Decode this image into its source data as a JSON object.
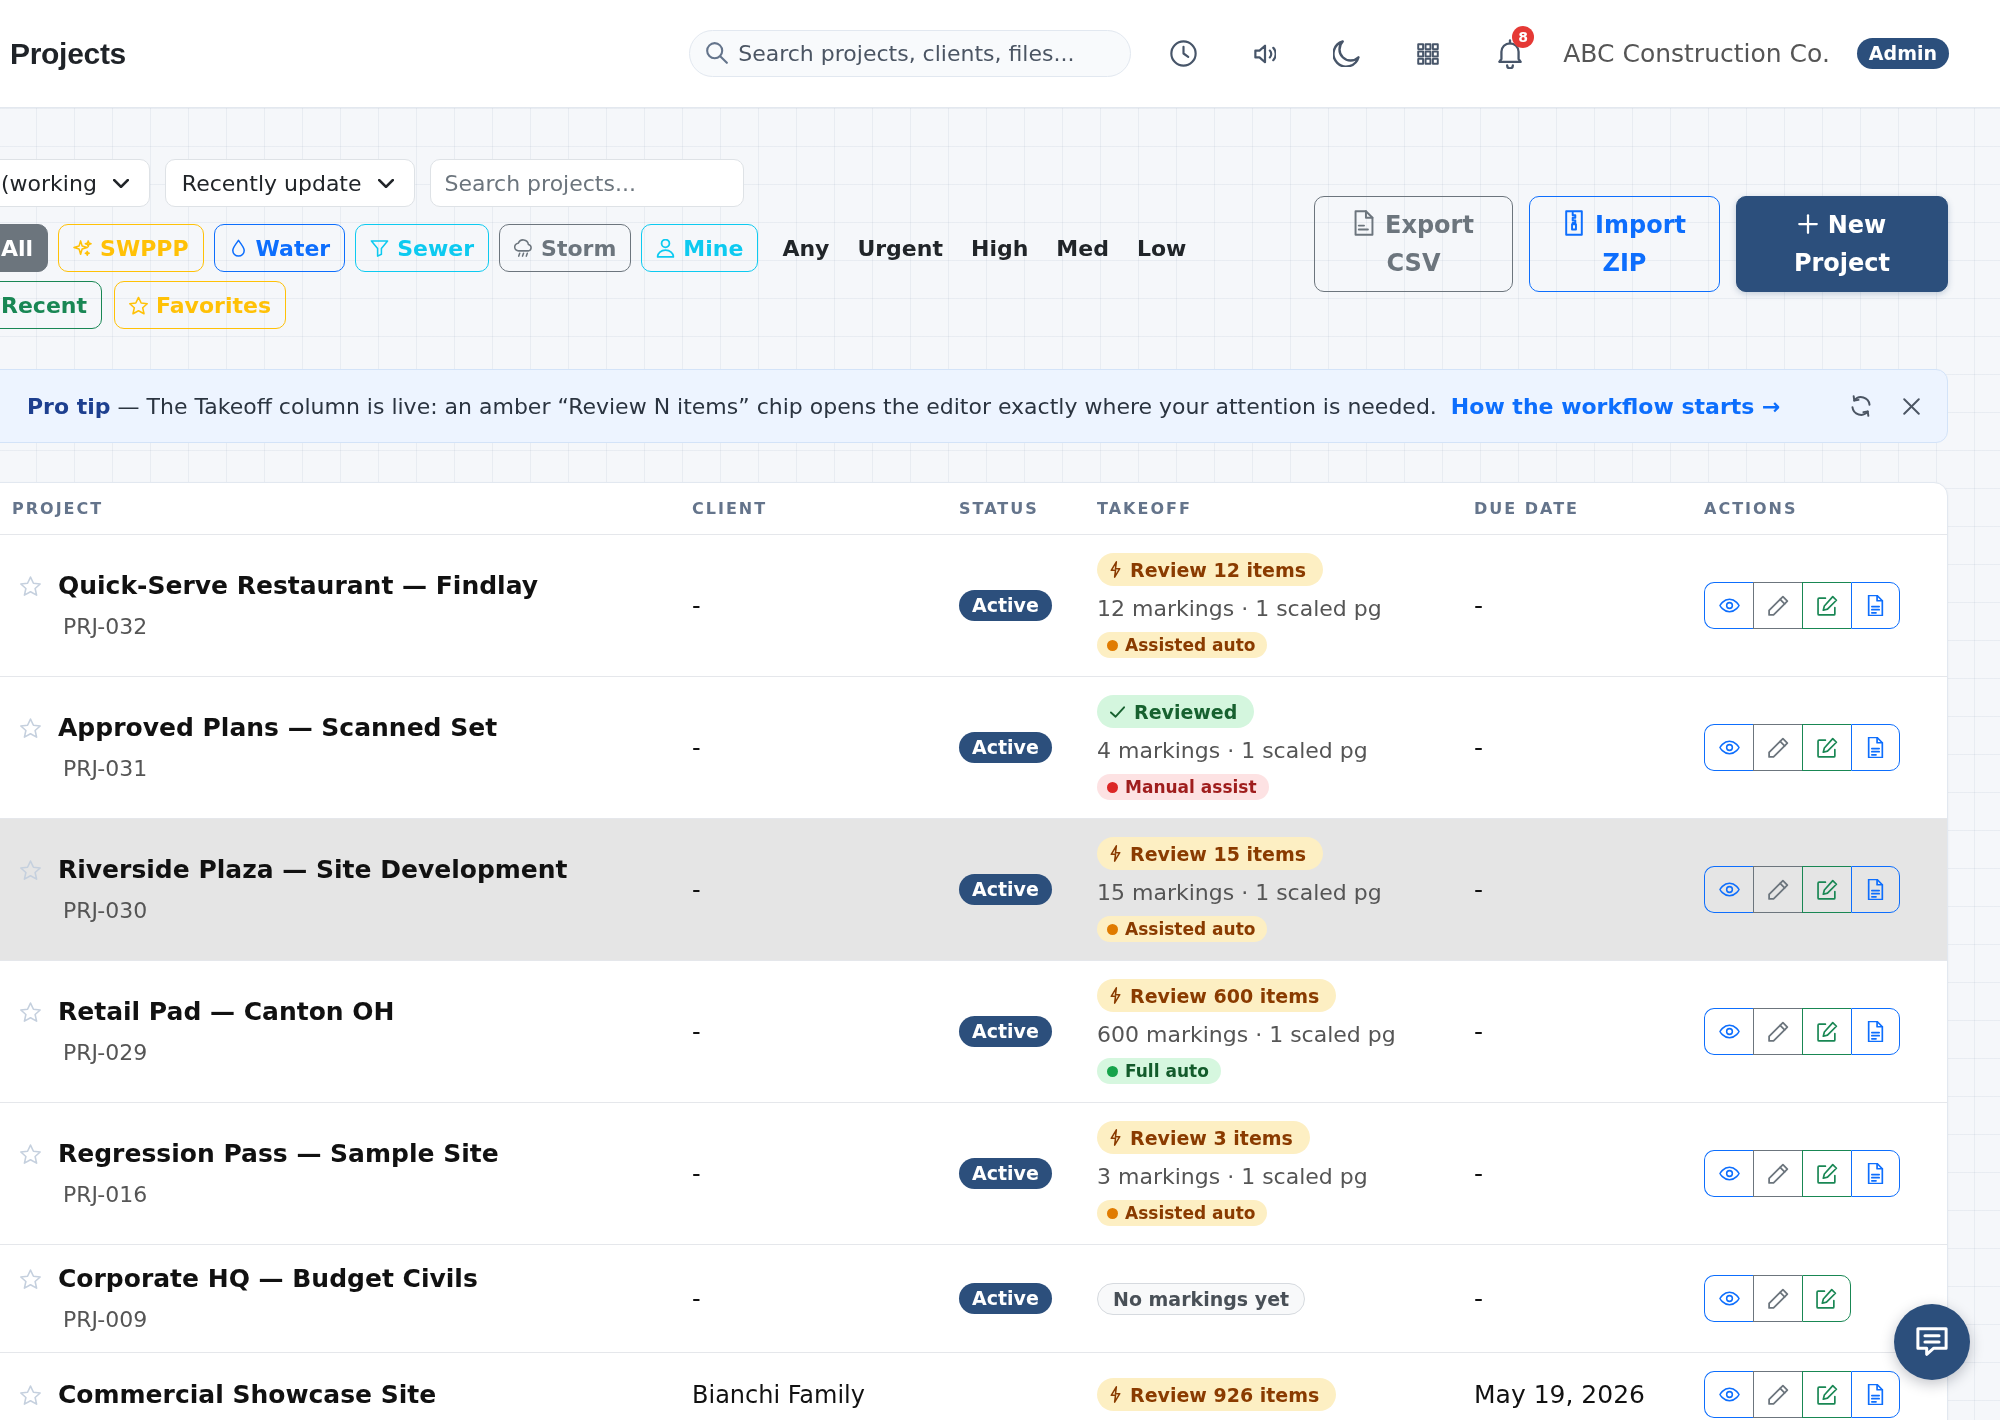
{
  "header": {
    "title": "Projects",
    "search": {
      "placeholder": "Search projects, clients, files..."
    },
    "notifications": "8",
    "company": "ABC Construction Co.",
    "role": "Admin"
  },
  "filters": {
    "dropdowns": [
      {
        "value": "(working"
      },
      {
        "value": "Recently update"
      }
    ],
    "search": {
      "placeholder": "Search projects..."
    },
    "chips": [
      {
        "label": "All",
        "kind": "plain",
        "selected": true,
        "color": "#6c757d"
      },
      {
        "label": "SWPPP",
        "kind": "sparkle",
        "selected": false,
        "color": "#ffc107"
      },
      {
        "label": "Water",
        "kind": "drop",
        "selected": false,
        "color": "#0d6efd"
      },
      {
        "label": "Sewer",
        "kind": "funnel",
        "selected": false,
        "color": "#0dcaf0"
      },
      {
        "label": "Storm",
        "kind": "rain",
        "selected": false,
        "color": "#6c757d"
      },
      {
        "label": "Mine",
        "kind": "person",
        "selected": false,
        "color": "#0dcaf0"
      }
    ],
    "priorities": [
      "Any",
      "Urgent",
      "High",
      "Med",
      "Low"
    ],
    "quick_chips": [
      {
        "label": "Recent",
        "kind": "plain",
        "selected": false,
        "color": "#198754"
      },
      {
        "label": "Favorites",
        "kind": "star",
        "selected": false,
        "color": "#ffc107"
      }
    ]
  },
  "toolbar": [
    {
      "label": "Export CSV",
      "kind": "export"
    },
    {
      "label": "Import ZIP",
      "kind": "import"
    },
    {
      "label": "New Project",
      "kind": "new"
    }
  ],
  "banner": {
    "text": "**Pro tip** — The Takeoff column is live: an amber “Review N items” chip opens the editor exactly where your attention is needed.",
    "link": "How the workflow starts →"
  },
  "table": {
    "columns": [
      "PROJECT",
      "CLIENT",
      "STATUS",
      "TAKEOFF",
      "DUE DATE",
      "ACTIONS"
    ],
    "rows": [
      {
        "favorite": false,
        "highlighted": false,
        "name": "Quick-Serve Restaurant — Findlay",
        "id": "PRJ-032",
        "client": "-",
        "status": {
          "label": "Active",
          "kind": "active"
        },
        "takeoff": {
          "kind": "review",
          "chip": "Review 12 items",
          "summary": "12 markings · 1 scaled pg",
          "mode": {
            "label": "Assisted auto",
            "kind": "assisted",
            "color": "#e07b00"
          }
        },
        "due": "-",
        "actions": [
          {
            "kind": "view"
          },
          {
            "kind": "rename"
          },
          {
            "kind": "edit"
          },
          {
            "kind": "report"
          }
        ]
      },
      {
        "favorite": false,
        "highlighted": false,
        "name": "Approved Plans — Scanned Set",
        "id": "PRJ-031",
        "client": "-",
        "status": {
          "label": "Active",
          "kind": "active"
        },
        "takeoff": {
          "kind": "reviewed",
          "chip": "Reviewed",
          "summary": "4 markings · 1 scaled pg",
          "mode": {
            "label": "Manual assist",
            "kind": "manual",
            "color": "#dc2626"
          }
        },
        "due": "-",
        "actions": [
          {
            "kind": "view"
          },
          {
            "kind": "rename"
          },
          {
            "kind": "edit"
          },
          {
            "kind": "report"
          }
        ]
      },
      {
        "favorite": false,
        "highlighted": true,
        "name": "Riverside Plaza — Site Development",
        "id": "PRJ-030",
        "client": "-",
        "status": {
          "label": "Active",
          "kind": "active"
        },
        "takeoff": {
          "kind": "review",
          "chip": "Review 15 items",
          "summary": "15 markings · 1 scaled pg",
          "mode": {
            "label": "Assisted auto",
            "kind": "assisted",
            "color": "#e07b00"
          }
        },
        "due": "-",
        "actions": [
          {
            "kind": "view"
          },
          {
            "kind": "rename"
          },
          {
            "kind": "edit"
          },
          {
            "kind": "report"
          }
        ]
      },
      {
        "favorite": false,
        "highlighted": false,
        "name": "Retail Pad — Canton OH",
        "id": "PRJ-029",
        "client": "-",
        "status": {
          "label": "Active",
          "kind": "active"
        },
        "takeoff": {
          "kind": "review",
          "chip": "Review 600 items",
          "summary": "600 markings · 1 scaled pg",
          "mode": {
            "label": "Full auto",
            "kind": "full",
            "color": "#16a34a"
          }
        },
        "due": "-",
        "actions": [
          {
            "kind": "view"
          },
          {
            "kind": "rename"
          },
          {
            "kind": "edit"
          },
          {
            "kind": "report"
          }
        ]
      },
      {
        "favorite": false,
        "highlighted": false,
        "name": "Regression Pass — Sample Site",
        "id": "PRJ-016",
        "client": "-",
        "status": {
          "label": "Active",
          "kind": "active"
        },
        "takeoff": {
          "kind": "review",
          "chip": "Review 3 items",
          "summary": "3 markings · 1 scaled pg",
          "mode": {
            "label": "Assisted auto",
            "kind": "assisted",
            "color": "#e07b00"
          }
        },
        "due": "-",
        "actions": [
          {
            "kind": "view"
          },
          {
            "kind": "rename"
          },
          {
            "kind": "edit"
          },
          {
            "kind": "report"
          }
        ]
      },
      {
        "favorite": false,
        "highlighted": false,
        "name": "Corporate HQ — Budget Civils",
        "id": "PRJ-009",
        "client": "-",
        "status": {
          "label": "Active",
          "kind": "active"
        },
        "takeoff": {
          "kind": "none",
          "chip": "No markings yet"
        },
        "due": "-",
        "actions": [
          {
            "kind": "view"
          },
          {
            "kind": "rename"
          },
          {
            "kind": "edit"
          }
        ]
      },
      {
        "favorite": false,
        "highlighted": false,
        "name": "Commercial Showcase Site",
        "client": "Bianchi Family",
        "takeoff": {
          "kind": "review",
          "chip": "Review 926 items"
        },
        "due": "May 19, 2026",
        "actions": [
          {
            "kind": "view"
          },
          {
            "kind": "rename"
          },
          {
            "kind": "edit"
          },
          {
            "kind": "report"
          }
        ]
      }
    ]
  }
}
